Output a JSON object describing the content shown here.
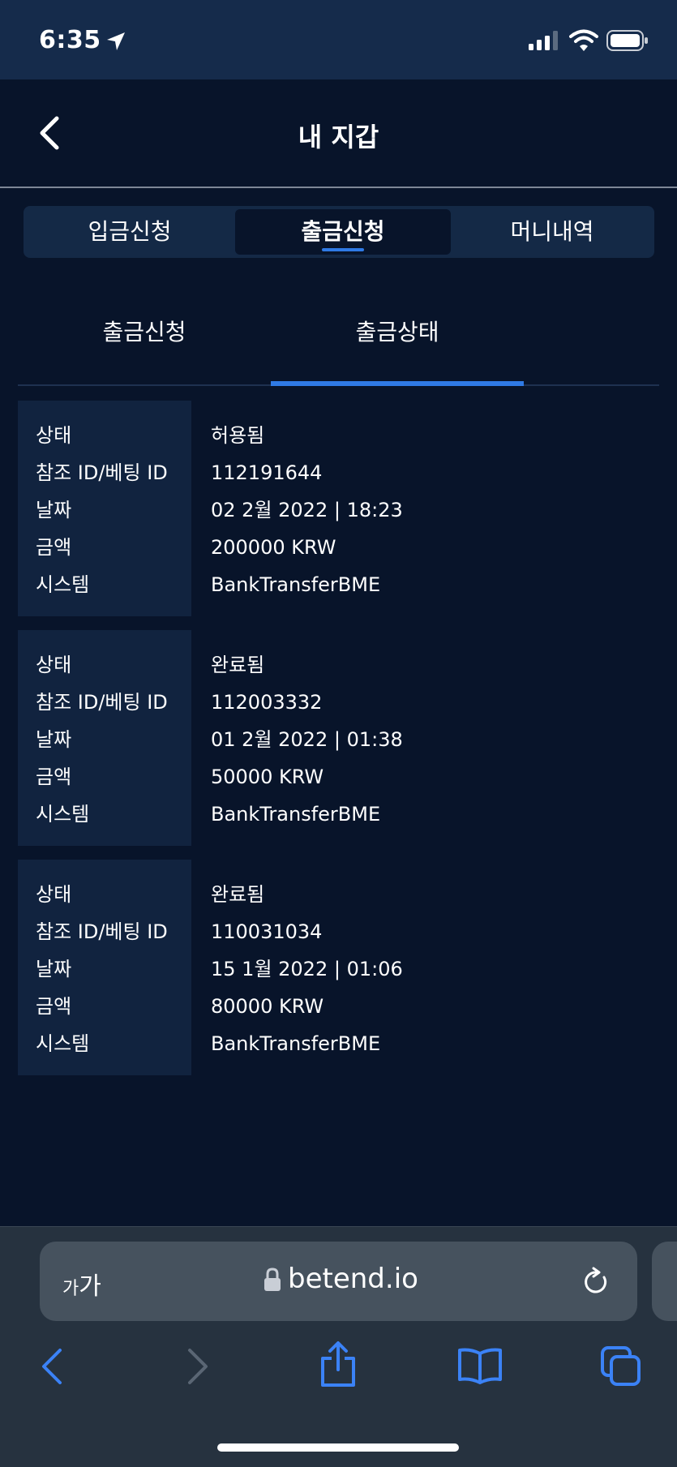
{
  "status_bar": {
    "time": "6:35"
  },
  "header": {
    "title": "내 지갑"
  },
  "main_tabs": [
    {
      "label": "입금신청",
      "active": false
    },
    {
      "label": "출금신청",
      "active": true
    },
    {
      "label": "머니내역",
      "active": false
    }
  ],
  "sub_tabs": [
    {
      "label": "출금신청",
      "active": false
    },
    {
      "label": "출금상태",
      "active": true
    }
  ],
  "record_labels": {
    "status": "상태",
    "ref_id": "참조 ID/베팅 ID",
    "date": "날짜",
    "amount": "금액",
    "system": "시스템"
  },
  "records": [
    {
      "status": "허용됨",
      "ref_id": "112191644",
      "date": "02 2월 2022 | 18:23",
      "amount": "200000 KRW",
      "system": "BankTransferBME"
    },
    {
      "status": "완료됨",
      "ref_id": "112003332",
      "date": "01 2월 2022 | 01:38",
      "amount": "50000 KRW",
      "system": "BankTransferBME"
    },
    {
      "status": "완료됨",
      "ref_id": "110031034",
      "date": "15 1월 2022 | 01:06",
      "amount": "80000 KRW",
      "system": "BankTransferBME"
    }
  ],
  "browser": {
    "text_size_small": "가",
    "text_size_large": "가",
    "url": "betend.io"
  },
  "colors": {
    "background": "#08142a",
    "accent": "#2f7ae5",
    "card_label_bg": "#11233f"
  }
}
